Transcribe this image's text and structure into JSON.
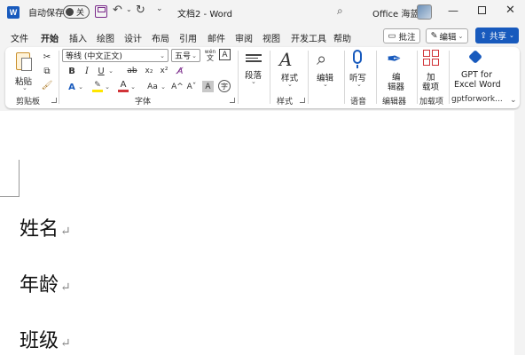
{
  "titlebar": {
    "app_icon": "W",
    "autosave_label": "自动保存",
    "autosave_state": "关",
    "doc_title": "文档2 - Word",
    "user_name": "Office 海蓝",
    "icons": [
      "word-logo-icon",
      "save-icon",
      "undo-icon",
      "redo-icon",
      "search-icon",
      "minimize-icon",
      "maximize-icon",
      "close-icon"
    ]
  },
  "tabs": [
    "文件",
    "开始",
    "插入",
    "绘图",
    "设计",
    "布局",
    "引用",
    "邮件",
    "审阅",
    "视图",
    "开发工具",
    "帮助"
  ],
  "active_tab": "开始",
  "actions": {
    "comment": "批注",
    "edit": "编辑",
    "share": "共享"
  },
  "ribbon": {
    "clipboard": {
      "paste": "粘贴",
      "group": "剪贴板"
    },
    "font": {
      "font_name": "等线 (中文正文)",
      "font_size": "五号",
      "wen": "wén",
      "char_border": "A",
      "bold": "B",
      "italic": "I",
      "underline": "U",
      "strike": "ab",
      "subscript": "x₂",
      "superscript": "x²",
      "grow": "A^",
      "shrink": "Aˇ",
      "case": "Aa",
      "group": "字体"
    },
    "paragraph": {
      "label": "段落"
    },
    "styles": {
      "label": "样式",
      "group": "样式"
    },
    "editing": {
      "label": "编辑"
    },
    "voice": {
      "label": "听写",
      "group": "语音"
    },
    "editor": {
      "label1": "编",
      "label2": "辑器",
      "group": "编辑器"
    },
    "addins": {
      "label1": "加",
      "label2": "载项",
      "group": "加载项"
    },
    "gpt": {
      "label1": "GPT for",
      "label2": "Excel Word",
      "group": "gptforwork..."
    }
  },
  "colors": {
    "accent": "#185abd",
    "highlight": "#ffe600",
    "font_color": "#d13438"
  },
  "document": {
    "paragraphs": [
      "姓名",
      "年龄",
      "班级"
    ],
    "para_mark": "↵"
  }
}
